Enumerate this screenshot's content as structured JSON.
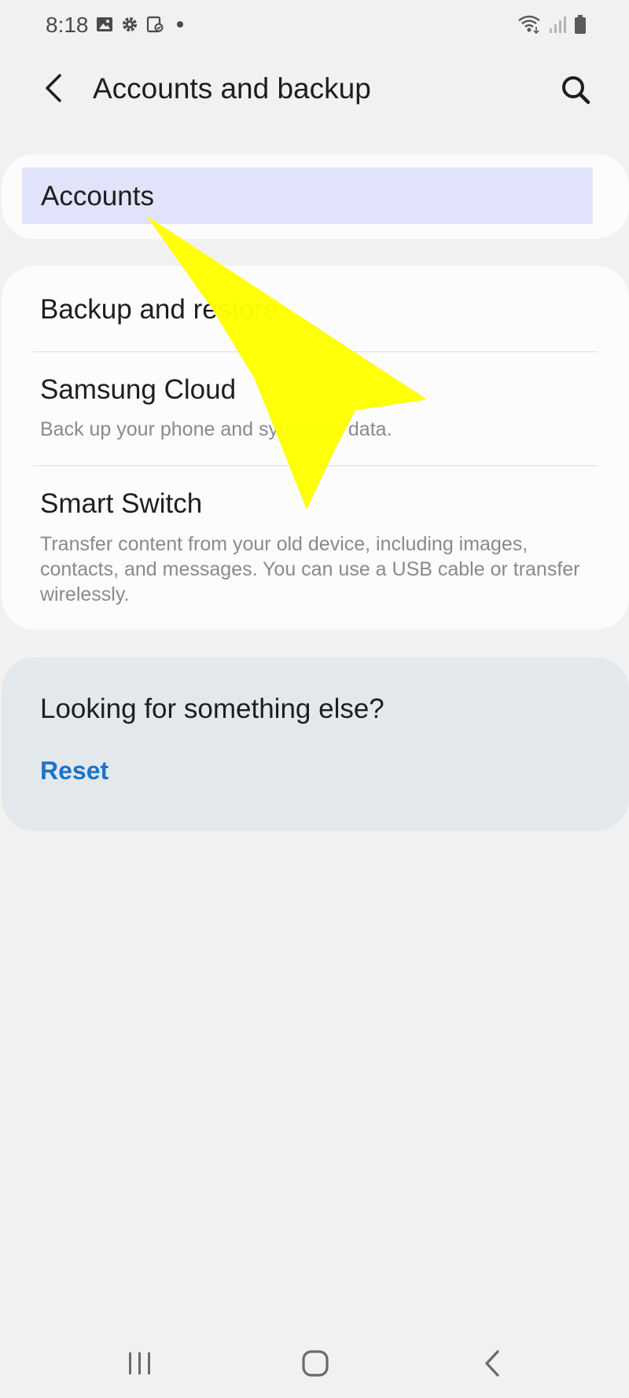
{
  "status_bar": {
    "time": "8:18"
  },
  "header": {
    "title": "Accounts and backup"
  },
  "accounts_card": {
    "label": "Accounts"
  },
  "backup_card": {
    "items": [
      {
        "title": "Backup and restore",
        "subtitle": ""
      },
      {
        "title": "Samsung Cloud",
        "subtitle": "Back up your phone and sync your data."
      },
      {
        "title": "Smart Switch",
        "subtitle": "Transfer content from your old device, including images, contacts, and messages. You can use a USB cable or transfer wirelessly."
      }
    ]
  },
  "suggest_card": {
    "title": "Looking for something else?",
    "link": "Reset"
  },
  "colors": {
    "background": "#f1f1f1",
    "card": "#fcfcfc",
    "highlight": "#e1e3fb",
    "suggest_card": "#e3e8ec",
    "link": "#1a74c9",
    "annotation_arrow": "#ffff00"
  },
  "icons": {
    "status_left": [
      "gallery-icon",
      "settings-icon",
      "device-care-icon",
      "notification-dot-icon"
    ],
    "status_right": [
      "wifi-icon",
      "signal-icon",
      "battery-icon"
    ],
    "nav": [
      "recents-icon",
      "home-icon",
      "back-icon"
    ]
  }
}
